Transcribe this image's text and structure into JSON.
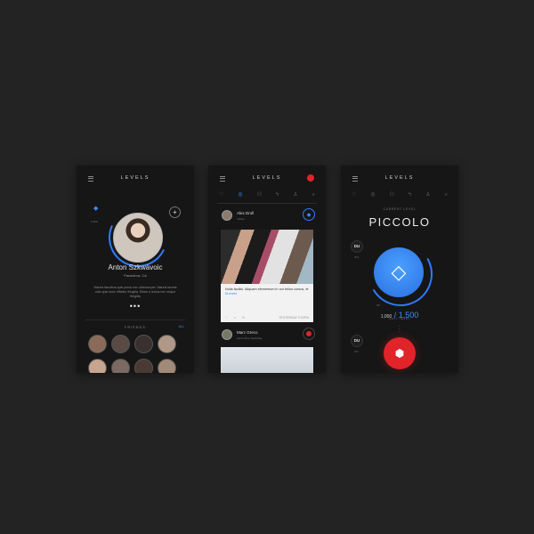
{
  "app": {
    "title": "LEVELS"
  },
  "profile": {
    "name": "Anton Szkwàvoic",
    "location": "Pasadena, CA",
    "bio": "Mauris faucibus quis purus nec ullamcorper. Mauris lacinia odio quis nunc efficitur fringilla. Etiam a lectus nec neque fringilla",
    "level_small": "1,000",
    "more": "•••"
  },
  "friends": {
    "label": "FRIENDS",
    "all_label": "ALL",
    "count": 8
  },
  "feed": {
    "post1": {
      "author": "Alex Droll",
      "subtitle": "Yellow",
      "text_main": "Nulla facilisi. Aliquam elementum in our tellus cursus, et ",
      "text_tag": "#Levels",
      "actions": [
        "♡",
        "☺",
        "⟲"
      ],
      "date": "YESTERDAY 9:00PM"
    },
    "post2": {
      "author": "Marc Greco",
      "subtitle": "Last online Yesterday"
    }
  },
  "level": {
    "current_label": "CURRENT LEVEL",
    "name": "PICCOLO",
    "badge_top": "DU",
    "badge_top_sub": "003",
    "progress_current": "1,000",
    "progress_separator": " / ",
    "progress_total": "1,500",
    "progress_sub": "XP",
    "next_label": "NEXT LEVEL",
    "badge_bottom": "DU",
    "badge_bottom_sub": "004"
  },
  "tabs": [
    "♡",
    "◎",
    "⚇",
    "ϟ",
    "♙",
    "⌕"
  ],
  "colors": {
    "accent": "#3d8bff",
    "alert": "#e0242a",
    "background": "#232323",
    "screen": "#161616"
  }
}
